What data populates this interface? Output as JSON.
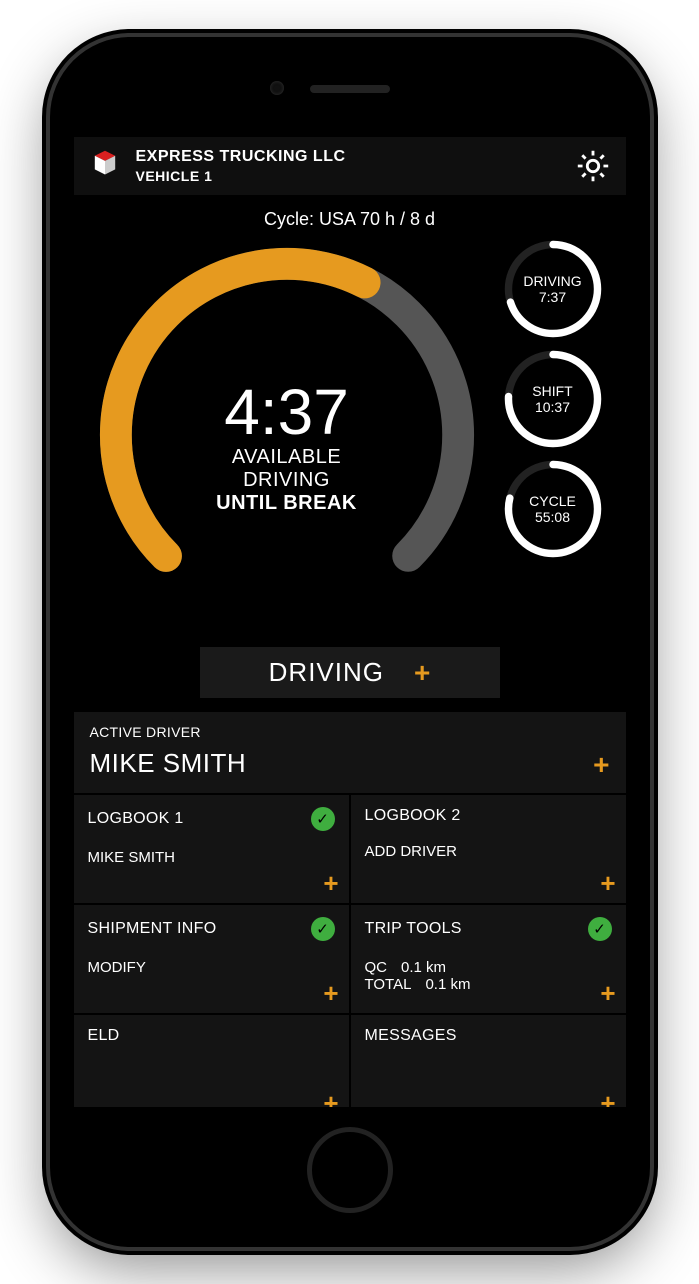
{
  "colors": {
    "accent": "#e69a1f",
    "ok": "#3fae3f"
  },
  "header": {
    "company": "EXPRESS TRUCKING LLC",
    "vehicle": "VEHICLE 1"
  },
  "dash": {
    "cycle_label": "Cycle: USA 70 h / 8 d",
    "main_time": "4:37",
    "main_line1": "AVAILABLE",
    "main_line2": "DRIVING",
    "main_line3": "UNTIL BREAK",
    "main_progress_pct": 60,
    "status_label": "DRIVING",
    "mini": [
      {
        "label": "DRIVING",
        "value": "7:37",
        "pct": 70
      },
      {
        "label": "SHIFT",
        "value": "10:37",
        "pct": 76
      },
      {
        "label": "CYCLE",
        "value": "55:08",
        "pct": 79
      }
    ]
  },
  "driver": {
    "label": "ACTIVE DRIVER",
    "name": "MIKE SMITH"
  },
  "tiles": {
    "logbook1": {
      "title": "LOGBOOK 1",
      "sub": "MIKE SMITH",
      "check": true
    },
    "logbook2": {
      "title": "LOGBOOK 2",
      "sub": "ADD DRIVER",
      "check": false
    },
    "shipment": {
      "title": "SHIPMENT INFO",
      "sub": "MODIFY",
      "check": true
    },
    "triptools": {
      "title": "TRIP TOOLS",
      "row1_label": "QC",
      "row1_val": "0.1 km",
      "row2_label": "TOTAL",
      "row2_val": "0.1 km",
      "check": true
    },
    "eld": {
      "title": "ELD"
    },
    "messages": {
      "title": "MESSAGES"
    }
  }
}
